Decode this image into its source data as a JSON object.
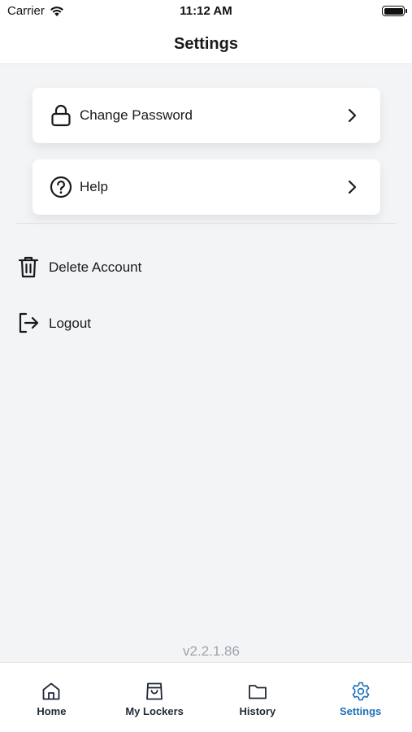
{
  "status_bar": {
    "carrier": "Carrier",
    "time": "11:12 AM"
  },
  "header": {
    "title": "Settings"
  },
  "cards": [
    {
      "label": "Change Password",
      "icon": "lock-icon"
    },
    {
      "label": "Help",
      "icon": "help-circle-icon"
    }
  ],
  "actions": [
    {
      "label": "Delete Account",
      "icon": "trash-icon"
    },
    {
      "label": "Logout",
      "icon": "logout-icon"
    }
  ],
  "version": "v2.2.1.86",
  "tabs": [
    {
      "label": "Home",
      "icon": "home-icon"
    },
    {
      "label": "My Lockers",
      "icon": "locker-bag-icon"
    },
    {
      "label": "History",
      "icon": "folder-icon"
    },
    {
      "label": "Settings",
      "icon": "gear-icon",
      "active": true
    }
  ],
  "colors": {
    "accent": "#1d6fb8",
    "background": "#f3f4f6",
    "text": "#1a1a1a",
    "muted": "#9ca3ab"
  }
}
